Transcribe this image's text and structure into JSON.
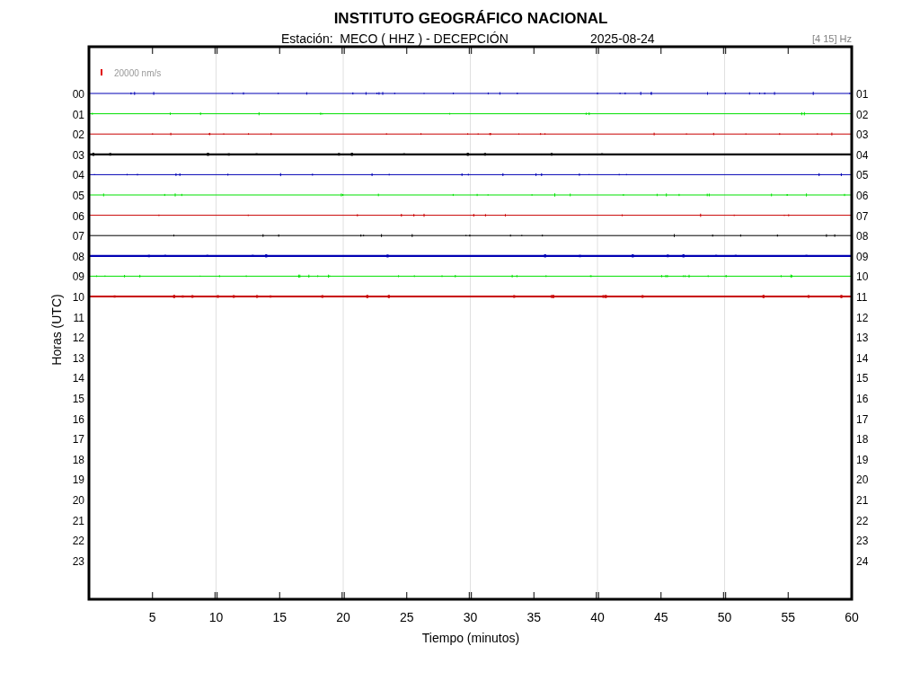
{
  "title": "INSTITUTO GEOGRÁFICO NACIONAL",
  "subtitle": {
    "station": "Estación:  MECO ( HHZ ) - DECEPCIÓN",
    "date": "2025-08-24"
  },
  "filter": "[4 15] Hz",
  "scale": {
    "label": "20000 nm/s"
  },
  "y_axis": {
    "label": "Horas (UTC)",
    "left_labels": [
      "00",
      "01",
      "02",
      "03",
      "04",
      "05",
      "06",
      "07",
      "08",
      "09",
      "10",
      "11",
      "12",
      "13",
      "14",
      "15",
      "16",
      "17",
      "18",
      "19",
      "20",
      "21",
      "22",
      "23"
    ],
    "right_labels": [
      "01",
      "02",
      "03",
      "04",
      "05",
      "06",
      "07",
      "08",
      "09",
      "10",
      "11",
      "12",
      "13",
      "14",
      "15",
      "16",
      "17",
      "18",
      "19",
      "20",
      "21",
      "22",
      "23",
      "24"
    ]
  },
  "x_axis": {
    "label": "Tiempo (minutos)",
    "ticks": [
      "5",
      "10",
      "15",
      "20",
      "25",
      "30",
      "35",
      "40",
      "45",
      "50",
      "55",
      "60"
    ]
  },
  "traces": [
    {
      "color": "#0000b4",
      "kind": "thin"
    },
    {
      "color": "#00e000",
      "kind": "thin"
    },
    {
      "color": "#c80000",
      "kind": "thin"
    },
    {
      "color": "#000000",
      "kind": "thick"
    },
    {
      "color": "#0000b4",
      "kind": "thin"
    },
    {
      "color": "#00e000",
      "kind": "thin"
    },
    {
      "color": "#c80000",
      "kind": "thin"
    },
    {
      "color": "#000000",
      "kind": "thin"
    },
    {
      "color": "#0000b4",
      "kind": "thick"
    },
    {
      "color": "#00e000",
      "kind": "thin"
    },
    {
      "color": "#c80000",
      "kind": "thick"
    }
  ]
}
